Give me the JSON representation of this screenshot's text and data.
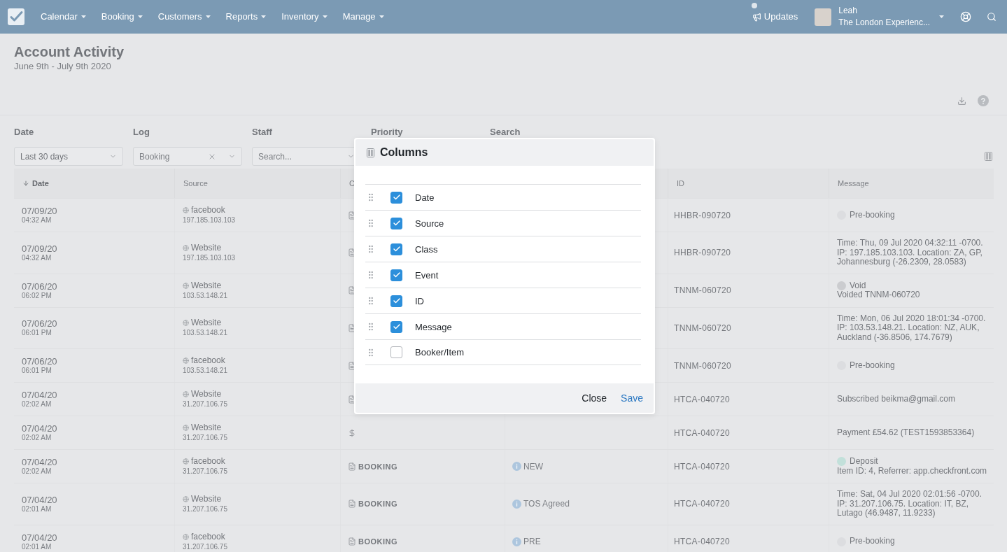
{
  "nav": {
    "menu": [
      {
        "label": "Calendar"
      },
      {
        "label": "Booking"
      },
      {
        "label": "Customers"
      },
      {
        "label": "Reports"
      },
      {
        "label": "Inventory"
      },
      {
        "label": "Manage"
      }
    ],
    "updates": {
      "label": "Updates",
      "unread": true
    },
    "user": {
      "name": "Leah",
      "company": "The London Experienc..."
    }
  },
  "page": {
    "title": "Account Activity",
    "subtitle": "June 9th - July 9th 2020"
  },
  "filters": [
    {
      "label": "Date",
      "kind": "select",
      "value": "Last 30 days"
    },
    {
      "label": "Log",
      "kind": "clearable",
      "value": "Booking"
    },
    {
      "label": "Staff",
      "kind": "select",
      "placeholder": "Search..."
    },
    {
      "label": "Priority",
      "kind": "covered"
    },
    {
      "label": "Search",
      "kind": "covered"
    }
  ],
  "table": {
    "columns": [
      {
        "kind": "label",
        "label": "Date",
        "sorted": true
      },
      {
        "kind": "label",
        "label": "Source",
        "sorted": false
      },
      {
        "kind": "label",
        "label": "C",
        "sorted": false
      },
      {
        "kind": "covered"
      },
      {
        "kind": "label",
        "label": "ID",
        "sorted": false
      },
      {
        "kind": "label",
        "label": "Message",
        "sorted": false
      }
    ],
    "rows": [
      {
        "date": "07/09/20",
        "time": "04:32 AM",
        "source": "facebook",
        "ip": "197.185.103.103",
        "class": {
          "kind": "booking"
        },
        "id": "HHBR-090720",
        "message": {
          "kind": "status",
          "status": "Pre-booking",
          "color": "#dcdde0"
        }
      },
      {
        "date": "07/09/20",
        "time": "04:32 AM",
        "source": "Website",
        "ip": "197.185.103.103",
        "class": {
          "kind": "booking"
        },
        "id": "HHBR-090720",
        "message": {
          "kind": "text",
          "text": "Time: Thu, 09 Jul 2020 04:32:11 -0700. IP: 197.185.103.103. Location: ZA, GP, Johannesburg (-26.2309, 28.0583)"
        }
      },
      {
        "date": "07/06/20",
        "time": "06:02 PM",
        "source": "Website",
        "ip": "103.53.148.21",
        "class": {
          "kind": "booking"
        },
        "id": "TNNM-060720",
        "message": {
          "kind": "status",
          "status": "Void",
          "color": "#cbcccf",
          "detail": "Voided TNNM-060720"
        }
      },
      {
        "date": "07/06/20",
        "time": "06:01 PM",
        "source": "Website",
        "ip": "103.53.148.21",
        "class": {
          "kind": "booking"
        },
        "id": "TNNM-060720",
        "message": {
          "kind": "text",
          "text": "Time: Mon, 06 Jul 2020 18:01:34 -0700. IP: 103.53.148.21. Location: NZ, AUK, Auckland (-36.8506, 174.7679)"
        }
      },
      {
        "date": "07/06/20",
        "time": "06:01 PM",
        "source": "facebook",
        "ip": "103.53.148.21",
        "class": {
          "kind": "booking"
        },
        "id": "TNNM-060720",
        "message": {
          "kind": "status",
          "status": "Pre-booking",
          "color": "#dcdde0"
        }
      },
      {
        "date": "07/04/20",
        "time": "02:02 AM",
        "source": "Website",
        "ip": "31.207.106.75",
        "class": {
          "kind": "booking"
        },
        "id": "HTCA-040720",
        "message": {
          "kind": "text",
          "text": "Subscribed beikma@gmail.com"
        }
      },
      {
        "date": "07/04/20",
        "time": "02:02 AM",
        "source": "Website",
        "ip": "31.207.106.75",
        "class": {
          "kind": "payment"
        },
        "id": "HTCA-040720",
        "message": {
          "kind": "text",
          "text": "Payment £54.62 (TEST1593853364)"
        }
      },
      {
        "date": "07/04/20",
        "time": "02:02 AM",
        "source": "facebook",
        "ip": "31.207.106.75",
        "class": {
          "kind": "booking",
          "label": "BOOKING"
        },
        "event": "NEW",
        "id": "HTCA-040720",
        "message": {
          "kind": "status",
          "status": "Deposit",
          "color": "#c2e0da",
          "detail": "Item ID: 4, Referrer: app.checkfront.com"
        }
      },
      {
        "date": "07/04/20",
        "time": "02:01 AM",
        "source": "Website",
        "ip": "31.207.106.75",
        "class": {
          "kind": "booking",
          "label": "BOOKING"
        },
        "event": "TOS Agreed",
        "id": "HTCA-040720",
        "message": {
          "kind": "text",
          "text": "Time: Sat, 04 Jul 2020 02:01:56 -0700. IP: 31.207.106.75. Location: IT, BZ, Lutago (46.9487, 11.9233)"
        }
      },
      {
        "date": "07/04/20",
        "time": "02:01 AM",
        "source": "facebook",
        "ip": "31.207.106.75",
        "class": {
          "kind": "booking",
          "label": "BOOKING"
        },
        "event": "PRE",
        "id": "HTCA-040720",
        "message": {
          "kind": "status",
          "status": "Pre-booking",
          "color": "#dcdde0"
        }
      }
    ]
  },
  "modal": {
    "title": "Columns",
    "options": [
      {
        "label": "Date",
        "checked": true
      },
      {
        "label": "Source",
        "checked": true
      },
      {
        "label": "Class",
        "checked": true
      },
      {
        "label": "Event",
        "checked": true
      },
      {
        "label": "ID",
        "checked": true
      },
      {
        "label": "Message",
        "checked": true
      },
      {
        "label": "Booker/Item",
        "checked": false
      }
    ],
    "buttons": [
      {
        "label": "Close",
        "kind": "secondary"
      },
      {
        "label": "Save",
        "kind": "primary"
      }
    ]
  }
}
